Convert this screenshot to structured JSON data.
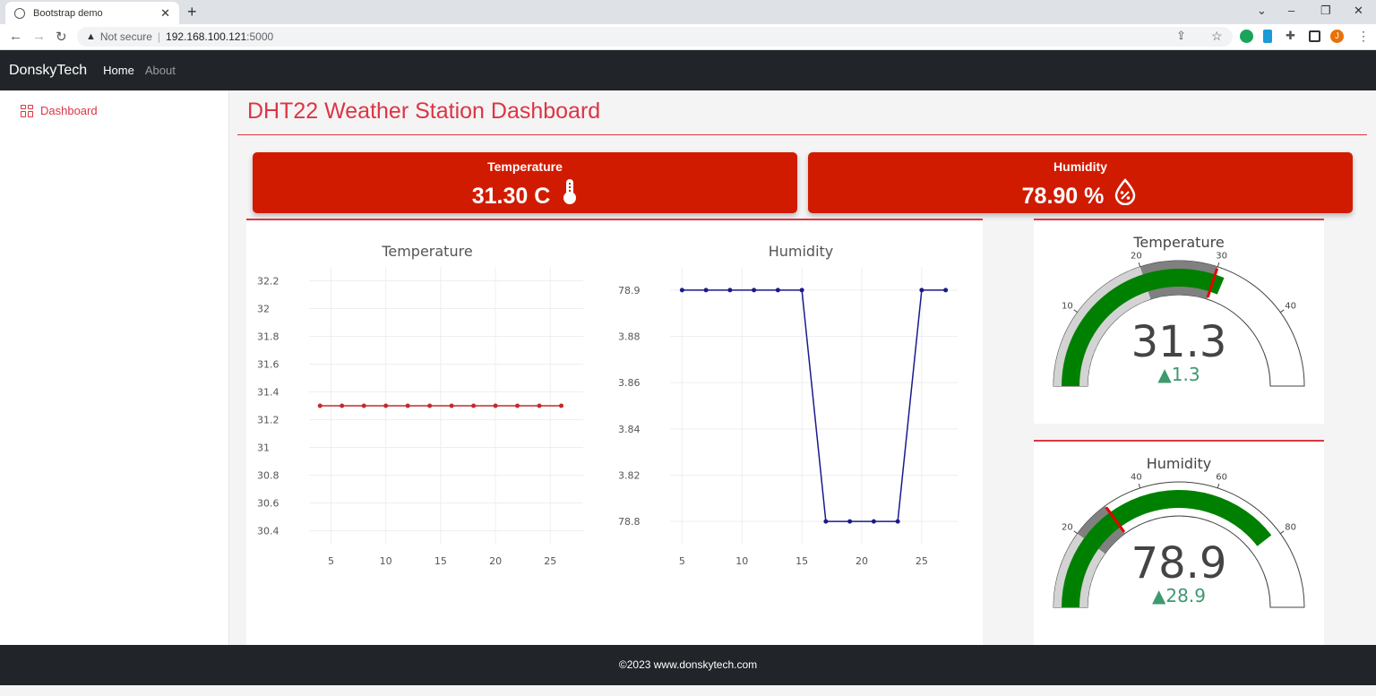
{
  "browser": {
    "tab_title": "Bootstrap demo",
    "not_secure": "Not secure",
    "host": "192.168.100.121",
    "port": ":5000",
    "profile_initial": "J"
  },
  "navbar": {
    "brand": "DonskyTech",
    "links": [
      {
        "label": "Home",
        "active": true
      },
      {
        "label": "About",
        "active": false
      }
    ]
  },
  "sidebar": {
    "items": [
      {
        "label": "Dashboard",
        "icon": "dashboard-icon"
      }
    ]
  },
  "page": {
    "title": "DHT22 Weather Station Dashboard"
  },
  "cards": {
    "temperature": {
      "label": "Temperature",
      "value": "31.30 C",
      "icon": "thermometer-icon"
    },
    "humidity": {
      "label": "Humidity",
      "value": "78.90 %",
      "icon": "humidity-drop-icon"
    }
  },
  "chart_data": [
    {
      "type": "line",
      "title": "Temperature",
      "color": "#c42a2a",
      "x": [
        4,
        6,
        8,
        10,
        12,
        14,
        16,
        18,
        20,
        22,
        24,
        26
      ],
      "y": [
        31.3,
        31.3,
        31.3,
        31.3,
        31.3,
        31.3,
        31.3,
        31.3,
        31.3,
        31.3,
        31.3,
        31.3
      ],
      "xticks": [
        5,
        10,
        15,
        20,
        25
      ],
      "yticks": [
        "30.4",
        "30.6",
        "30.8",
        "31",
        "31.2",
        "31.4",
        "31.6",
        "31.8",
        "32",
        "32.2"
      ],
      "xlim": [
        3,
        28
      ],
      "ylim": [
        30.3,
        32.3
      ],
      "grid": true
    },
    {
      "type": "line",
      "title": "Humidity",
      "color": "#1a1a8c",
      "x": [
        5,
        7,
        9,
        11,
        13,
        15,
        17,
        19,
        21,
        23,
        25,
        27
      ],
      "y": [
        78.9,
        78.9,
        78.9,
        78.9,
        78.9,
        78.9,
        78.8,
        78.8,
        78.8,
        78.8,
        78.9,
        78.9
      ],
      "xticks": [
        5,
        10,
        15,
        20,
        25
      ],
      "yticks": [
        "78.8",
        "3.82",
        "3.84",
        "3.86",
        "3.88",
        "78.9"
      ],
      "ytick_values": [
        78.8,
        78.82,
        78.84,
        78.86,
        78.88,
        78.9
      ],
      "xlim": [
        4,
        28
      ],
      "ylim": [
        78.79,
        78.91
      ],
      "grid": true
    }
  ],
  "gauges": [
    {
      "title": "Temperature",
      "value": 31.3,
      "value_text": "31.3",
      "delta_text": "▲1.3",
      "range": [
        0,
        50
      ],
      "ticks": [
        10,
        20,
        30,
        40
      ],
      "steps": [
        {
          "from": 0,
          "to": 20,
          "color": "#d3d3d3"
        },
        {
          "from": 20,
          "to": 30,
          "color": "#808080"
        }
      ],
      "threshold": 30,
      "bar_color": "#008000",
      "delta_color": "#3d9970"
    },
    {
      "title": "Humidity",
      "value": 78.9,
      "value_text": "78.9",
      "delta_text": "▲28.9",
      "range": [
        0,
        100
      ],
      "ticks": [
        20,
        40,
        60,
        80
      ],
      "steps": [
        {
          "from": 0,
          "to": 20,
          "color": "#d3d3d3"
        },
        {
          "from": 20,
          "to": 30,
          "color": "#808080"
        }
      ],
      "threshold": 30,
      "bar_color": "#008000",
      "delta_color": "#3d9970"
    }
  ],
  "footer": {
    "text": "©2023 www.donskytech.com"
  },
  "colors": {
    "accent": "#dc3545",
    "card_bg": "#d11b00",
    "navbar_bg": "#212529"
  }
}
